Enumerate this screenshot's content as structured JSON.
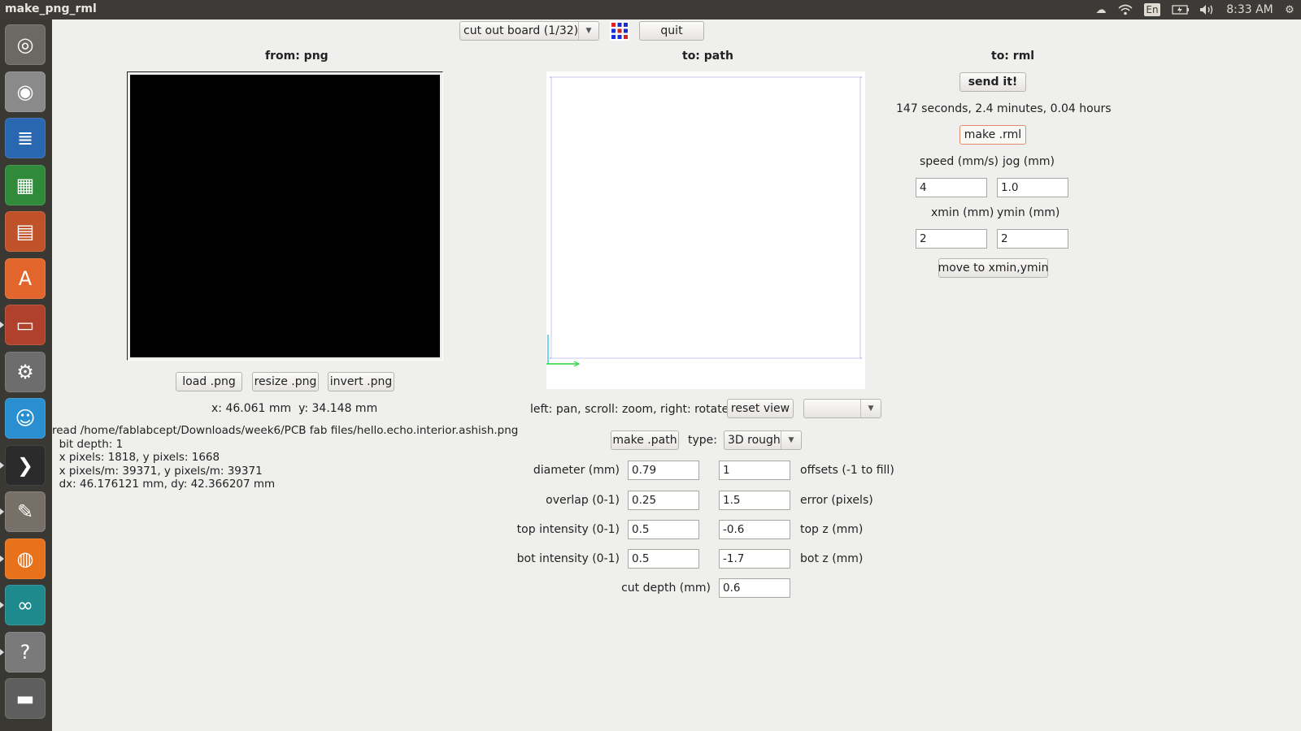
{
  "window": {
    "title": "make_png_rml"
  },
  "topbar": {
    "keyboard": "En",
    "time": "8:33 AM"
  },
  "launcher": {
    "items": [
      {
        "name": "ubuntu-dash-icon",
        "color": "#6b6963",
        "glyph": "◎"
      },
      {
        "name": "camera-icon",
        "color": "#8a8a8a",
        "glyph": "◉"
      },
      {
        "name": "writer-icon",
        "color": "#2a67b1",
        "glyph": "≣"
      },
      {
        "name": "calc-icon",
        "color": "#2f8a3a",
        "glyph": "▦"
      },
      {
        "name": "impress-icon",
        "color": "#c0522a",
        "glyph": "▤"
      },
      {
        "name": "software-center-icon",
        "color": "#e2662c",
        "glyph": "A"
      },
      {
        "name": "file-cabinet-icon",
        "color": "#b0412c",
        "glyph": "▭"
      },
      {
        "name": "system-settings-icon",
        "color": "#6d6d6d",
        "glyph": "⚙"
      },
      {
        "name": "empathy-chat-icon",
        "color": "#2a8fd0",
        "glyph": "☺"
      },
      {
        "name": "terminal-icon",
        "color": "#2b2b2b",
        "glyph": "❯"
      },
      {
        "name": "gimp-icon",
        "color": "#777068",
        "glyph": "✎"
      },
      {
        "name": "firefox-icon",
        "color": "#e8711c",
        "glyph": "◍"
      },
      {
        "name": "arduino-icon",
        "color": "#1f8a8e",
        "glyph": "∞"
      },
      {
        "name": "help-icon",
        "color": "#7a7a7a",
        "glyph": "?"
      },
      {
        "name": "trash-icon",
        "color": "#5e5e5e",
        "glyph": "▬"
      }
    ]
  },
  "toolbar": {
    "process_select": "cut out board (1/32)",
    "quit_label": "quit"
  },
  "png_panel": {
    "header": "from: png",
    "load_label": "load .png",
    "resize_label": "resize .png",
    "invert_label": "invert .png",
    "coords": "x: 46.061 mm  y: 34.148 mm",
    "info_lines": [
      "read /home/fablabcept/Downloads/week6/PCB fab files/hello.echo.interior.ashish.png",
      "  bit depth: 1",
      "  x pixels: 1818, y pixels: 1668",
      "  x pixels/m: 39371, y pixels/m: 39371",
      "  dx: 46.176121 mm, dy: 42.366207 mm"
    ]
  },
  "path_panel": {
    "header": "to: path",
    "view_hint": "left: pan, scroll: zoom, right: rotate",
    "reset_view_label": "reset view",
    "view_select": "",
    "make_path_label": "make .path",
    "type_label": "type:",
    "type_value": "3D rough",
    "params": {
      "diameter_label": "diameter (mm)",
      "diameter": "0.79",
      "offsets_label": "offsets (-1 to fill)",
      "offsets": "1",
      "overlap_label": "overlap (0-1)",
      "overlap": "0.25",
      "error_label": "error (pixels)",
      "error": "1.5",
      "top_intensity_label": "top intensity (0-1)",
      "top_intensity": "0.5",
      "top_z_label": "top z (mm)",
      "top_z": "-0.6",
      "bot_intensity_label": "bot intensity (0-1)",
      "bot_intensity": "0.5",
      "bot_z_label": "bot z (mm)",
      "bot_z": "-1.7",
      "cut_depth_label": "cut depth (mm)",
      "cut_depth": "0.6"
    }
  },
  "rml_panel": {
    "header": "to: rml",
    "send_label": "send it!",
    "time_estimate": "147 seconds, 2.4 minutes, 0.04 hours",
    "make_rml_label": "make .rml",
    "speed_label": "speed (mm/s)",
    "speed": "4",
    "jog_label": "jog (mm)",
    "jog": "1.0",
    "xmin_label": "xmin (mm)",
    "xmin": "2",
    "ymin_label": "ymin (mm)",
    "ymin": "2",
    "move_label": "move to xmin,ymin"
  }
}
